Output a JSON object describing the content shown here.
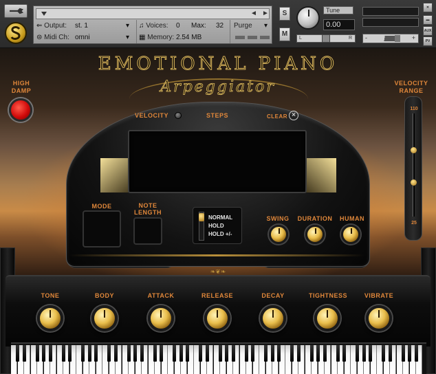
{
  "header": {
    "output_label": "Output:",
    "output_value": "st. 1",
    "midi_label": "Midi Ch:",
    "midi_value": "omni",
    "voices_label": "Voices:",
    "voices_value": "0",
    "max_label": "Max:",
    "max_value": "32",
    "purge_label": "Purge",
    "memory_label": "Memory:",
    "memory_value": "2.54 MB",
    "s_label": "S",
    "m_label": "M",
    "tune_label": "Tune",
    "tune_value": "0.00",
    "pan_left": "L",
    "pan_right": "R",
    "vol_minus": "-",
    "vol_plus": "+",
    "aux_label": "AUX",
    "pv_label": "PV",
    "nav_prev": "◄",
    "nav_next": "►"
  },
  "instrument": {
    "title": "EMOTIONAL PIANO",
    "subtitle": "Arpeggiator",
    "high_damp": "HIGH DAMP",
    "velocity_range": "VELOCITY RANGE",
    "velocity_range_max": "110",
    "velocity_range_min": "25",
    "velocity_label": "VELOCITY",
    "steps_label": "STEPS",
    "clear_label": "CLEAR",
    "mode_label": "MODE",
    "note_length_label": "NOTE LENGTH",
    "mode_options": [
      "NORMAL",
      "HOLD",
      "HOLD +/-"
    ],
    "arp_knobs": [
      "SWING",
      "DURATION",
      "HUMAN"
    ],
    "main_knobs": [
      "TONE",
      "BODY",
      "ATTACK",
      "RELEASE",
      "DECAY",
      "TIGHTNESS",
      "VIBRATE"
    ]
  },
  "colors": {
    "accent_orange": "#e0873a",
    "gold": "#d9b55c",
    "led_red": "#d10b0b"
  },
  "icons": {
    "settings": "wrench-icon",
    "logo": "s-logo-icon",
    "clear": "close-circle-icon"
  }
}
